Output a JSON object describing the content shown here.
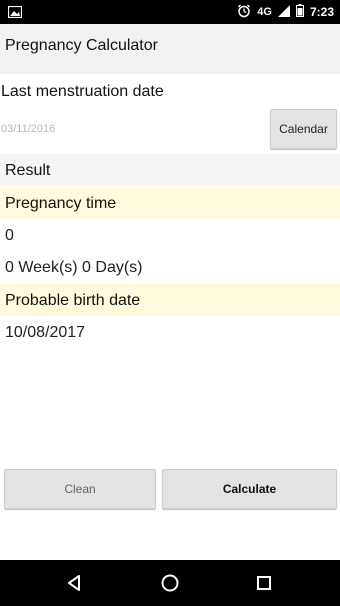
{
  "status_bar": {
    "network": "4G",
    "time": "7:23",
    "icons": [
      "image-icon",
      "alarm-icon",
      "signal-icon",
      "battery-icon"
    ]
  },
  "header": {
    "title": "Pregnancy Calculator"
  },
  "form": {
    "last_menstruation_label": "Last menstruation date",
    "date_placeholder": "03/11/2016",
    "date_value": "",
    "calendar_button": "Calendar"
  },
  "result": {
    "section_label": "Result",
    "pregnancy_time_label": "Pregnancy time",
    "pregnancy_time_value": "0",
    "pregnancy_time_weeks": "0 Week(s) 0 Day(s)",
    "birth_date_label": "Probable birth date",
    "birth_date_value": "10/08/2017"
  },
  "actions": {
    "clean_label": "Clean",
    "calculate_label": "Calculate"
  },
  "nav": {
    "icons": [
      "back-icon",
      "home-icon",
      "recents-icon"
    ]
  },
  "colors": {
    "header_bg": "#f2f2f2",
    "highlight_row": "#fffbdc",
    "result_row": "#f5f5f5",
    "button_bg": "#e3e3e3",
    "system_bar": "#000000"
  }
}
